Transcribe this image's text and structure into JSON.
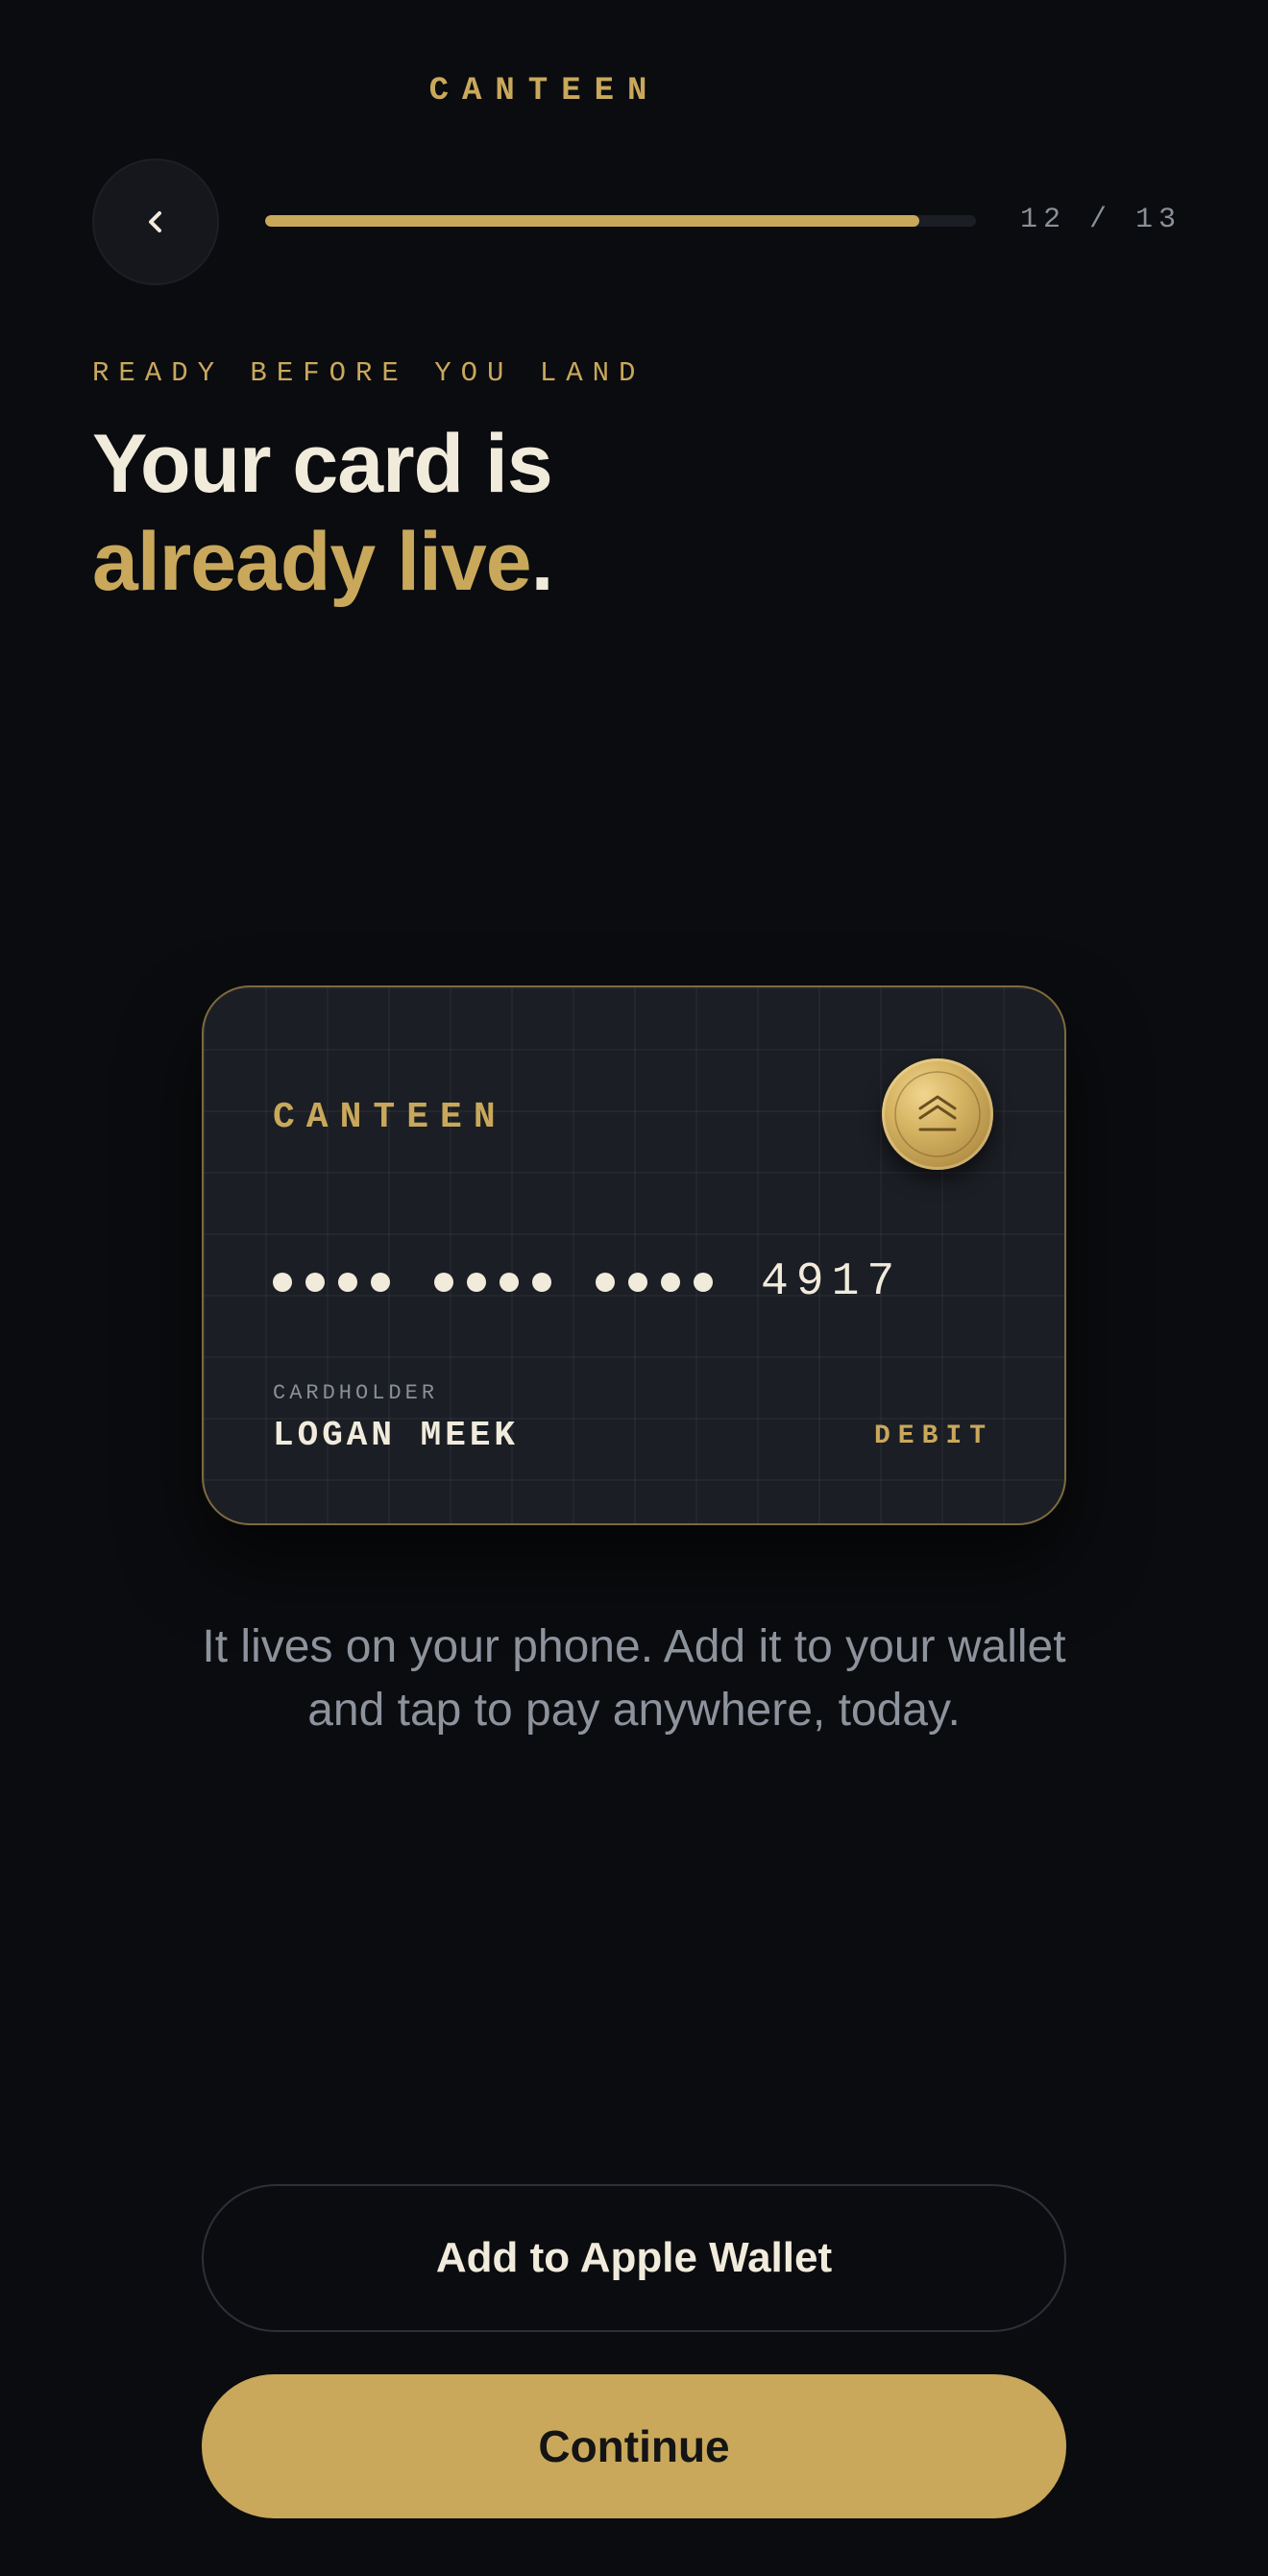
{
  "header": {
    "brand": "CANTEEN",
    "progress": {
      "current": 12,
      "total": 13,
      "label": "12 / 13",
      "fill_fraction": 0.92
    }
  },
  "intro": {
    "eyebrow": "READY BEFORE YOU LAND",
    "headline_line1": "Your card is",
    "headline_line2_gold": "already live",
    "headline_line2_end": "."
  },
  "card": {
    "brand": "CANTEEN",
    "number_mask_groups": 3,
    "last4": "4917",
    "holder_label": "CARDHOLDER",
    "holder_name": "LOGAN MEEK",
    "type": "DEBIT",
    "seal_icon": "chevron-stack-icon"
  },
  "body": {
    "text": "It lives on your phone. Add it to your wallet and tap to pay anywhere, today."
  },
  "actions": {
    "wallet_label": "Add to Apple Wallet",
    "continue_label": "Continue"
  },
  "colors": {
    "background": "#0b0c0f",
    "accent_gold": "#c9a85c",
    "text_primary": "#f1ebdc",
    "text_muted": "#8d939d",
    "card_surface": "#1b1e24"
  }
}
